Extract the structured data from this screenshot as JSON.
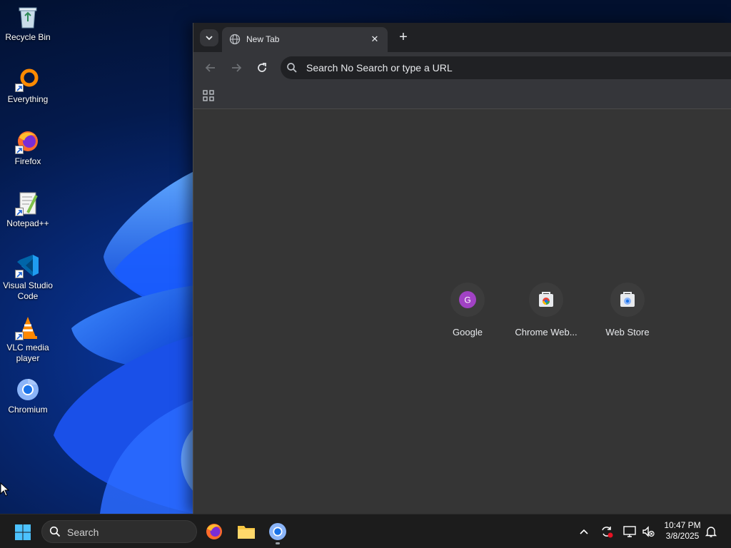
{
  "desktop": {
    "icons": [
      {
        "label": "Recycle Bin",
        "icon": "recycle-bin-icon"
      },
      {
        "label": "Everything",
        "icon": "everything-icon"
      },
      {
        "label": "Firefox",
        "icon": "firefox-icon"
      },
      {
        "label": "Notepad++",
        "icon": "notepad-plus-plus-icon"
      },
      {
        "label": "Visual Studio Code",
        "icon": "vscode-icon"
      },
      {
        "label": "VLC media player",
        "icon": "vlc-icon"
      },
      {
        "label": "Chromium",
        "icon": "chromium-icon"
      }
    ]
  },
  "browser": {
    "tab": {
      "title": "New Tab",
      "close": "✕"
    },
    "new_tab": "+",
    "omnibox": {
      "text": "Search No Search or type a URL"
    },
    "shortcuts": [
      {
        "label": "Google",
        "letter": "G",
        "color": "#a142c4"
      },
      {
        "label": "Chrome Web...",
        "icon": "web-store-icon"
      },
      {
        "label": "Web Store",
        "icon": "web-store-icon"
      }
    ]
  },
  "taskbar": {
    "search_label": "Search",
    "apps": [
      "firefox-icon",
      "file-explorer-icon",
      "chromium-icon"
    ],
    "clock": {
      "time": "10:47 PM",
      "date": "3/8/2025"
    }
  },
  "colors": {
    "accent_blue": "#0067c0",
    "window_bg": "#353535",
    "tabstrip_bg": "#202124"
  }
}
